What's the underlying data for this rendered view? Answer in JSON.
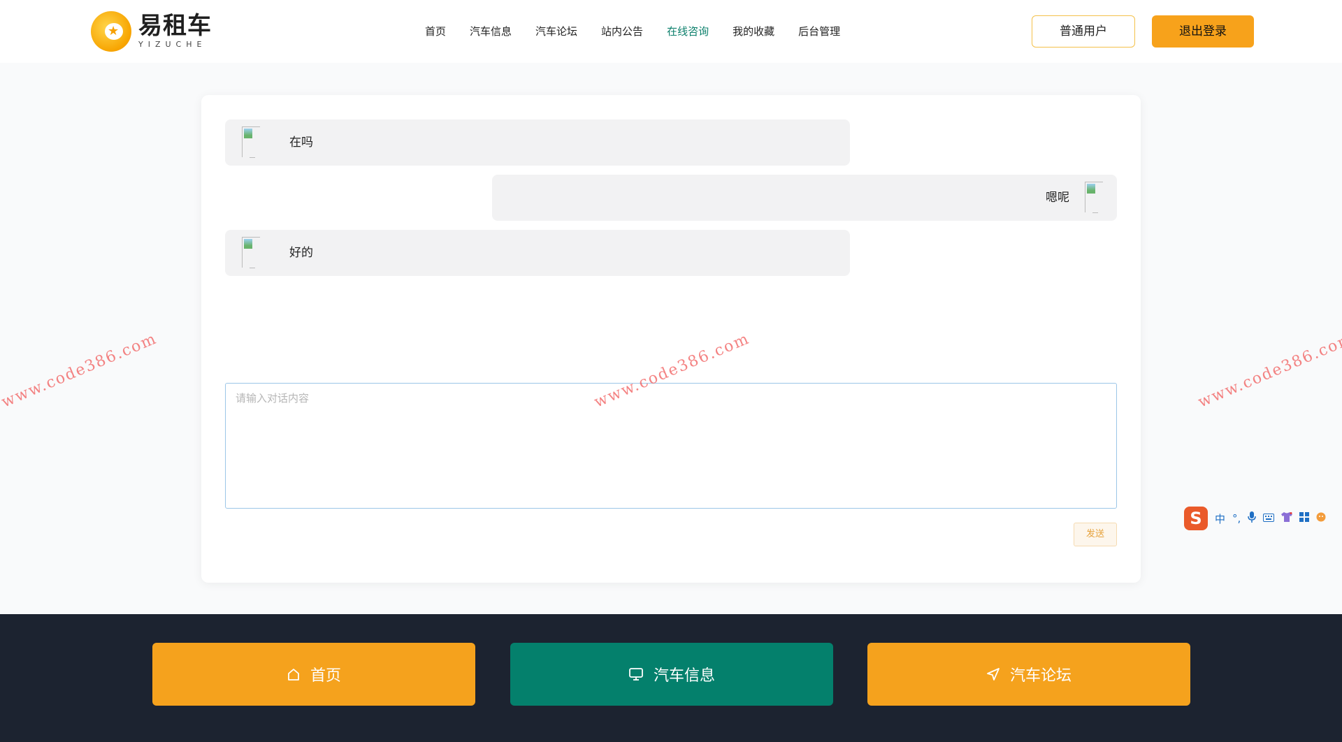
{
  "header": {
    "logo": {
      "cn": "易租车",
      "en": "YIZUCHE"
    },
    "nav": [
      {
        "label": "首页"
      },
      {
        "label": "汽车信息"
      },
      {
        "label": "汽车论坛"
      },
      {
        "label": "站内公告"
      },
      {
        "label": "在线咨询",
        "active": true
      },
      {
        "label": "我的收藏"
      },
      {
        "label": "后台管理"
      }
    ],
    "user_button": "普通用户",
    "logout_button": "退出登录"
  },
  "chat": {
    "messages": [
      {
        "side": "left",
        "text": "在吗"
      },
      {
        "side": "right",
        "text": "嗯呢"
      },
      {
        "side": "left",
        "text": "好的"
      }
    ],
    "input": {
      "placeholder": "请输入对话内容",
      "value": ""
    },
    "send_label": "发送"
  },
  "watermark": "www.code386.com",
  "ime": {
    "logo": "S",
    "mode": "中"
  },
  "footer": {
    "buttons": [
      {
        "label": "首页",
        "icon": "home-icon"
      },
      {
        "label": "汽车信息",
        "icon": "monitor-icon"
      },
      {
        "label": "汽车论坛",
        "icon": "navigation-icon"
      }
    ]
  },
  "colors": {
    "accent_orange": "#f5a21d",
    "accent_teal": "#04806c",
    "nav_active": "#0b7f6b",
    "footer_bg": "#1c2330"
  }
}
